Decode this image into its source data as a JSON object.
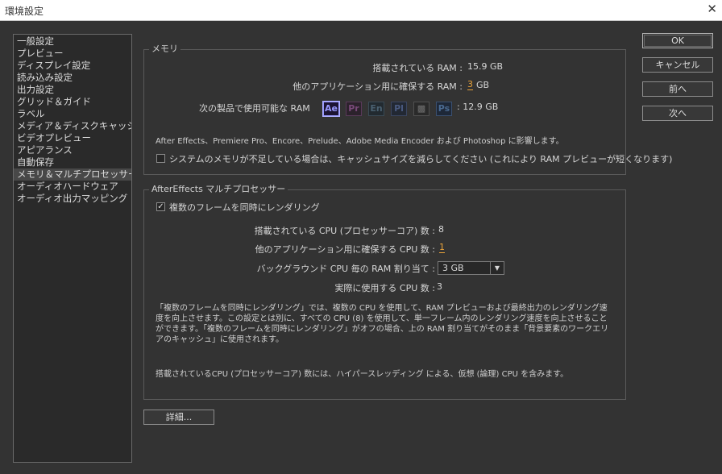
{
  "window": {
    "title": "環境設定",
    "close_glyph": "✕"
  },
  "sidebar": {
    "items": [
      {
        "label": "一般設定"
      },
      {
        "label": "プレビュー"
      },
      {
        "label": "ディスプレイ設定"
      },
      {
        "label": "読み込み設定"
      },
      {
        "label": "出力設定"
      },
      {
        "label": "グリッド＆ガイド"
      },
      {
        "label": "ラベル"
      },
      {
        "label": "メディア＆ディスクキャッシュ"
      },
      {
        "label": "ビデオプレビュー"
      },
      {
        "label": "アピアランス"
      },
      {
        "label": "自動保存"
      },
      {
        "label": "メモリ＆マルチプロセッサー",
        "selected": true
      },
      {
        "label": "オーディオハードウェア"
      },
      {
        "label": "オーディオ出力マッピング"
      }
    ]
  },
  "memory": {
    "legend": "メモリ",
    "installed_label": "搭載されている RAM :",
    "installed_value": "15.9 GB",
    "reserved_label": "他のアプリケーション用に確保する RAM :",
    "reserved_value": "3",
    "reserved_unit": "GB",
    "available_label": "次の製品で使用可能な RAM",
    "available_value": ": 12.9 GB",
    "apps": [
      {
        "abbr": "Ae",
        "icon": "after-effects-icon",
        "fg": "#9999ff",
        "bg": "#1c1433",
        "border": "#9999ff"
      },
      {
        "abbr": "Pr",
        "icon": "premiere-pro-icon",
        "fg": "#7a4a7a",
        "bg": "#2c222c",
        "border": "#5a3a5a"
      },
      {
        "abbr": "En",
        "icon": "encore-icon",
        "fg": "#4a6070",
        "bg": "#222a30",
        "border": "#3a4a55"
      },
      {
        "abbr": "Pl",
        "icon": "prelude-icon",
        "fg": "#4a5a80",
        "bg": "#222833",
        "border": "#3a4560"
      },
      {
        "abbr": "▩",
        "icon": "media-encoder-icon",
        "fg": "#707070",
        "bg": "#2a2a2a",
        "border": "#505050"
      },
      {
        "abbr": "Ps",
        "icon": "photoshop-icon",
        "fg": "#4a6a90",
        "bg": "#1e2838",
        "border": "#3a5070"
      }
    ],
    "note": "After Effects、Premiere Pro、Encore、Prelude、Adobe Media Encoder および Photoshop に影響します。",
    "reduce_cache_label": "システムのメモリが不足している場合は、キャッシュサイズを減らしてください (これにより RAM プレビューが短くなります)",
    "reduce_cache_checked": false
  },
  "mp": {
    "legend": "AfterEffects マルチプロセッサー",
    "render_multi_label": "複数のフレームを同時にレンダリング",
    "render_multi_checked": true,
    "cpu_installed_label": "搭載されている CPU (プロセッサーコア) 数 :",
    "cpu_installed_value": "8",
    "cpu_reserved_label": "他のアプリケーション用に確保する CPU 数 :",
    "cpu_reserved_value": "1",
    "bg_ram_label": "バックグラウンド CPU 毎の RAM 割り当て :",
    "bg_ram_value": "3 GB",
    "actual_cpu_label": "実際に使用する CPU 数 :",
    "actual_cpu_value": "3",
    "description": "「複数のフレームを同時にレンダリング」では、複数の CPU を使用して、RAM プレビューおよび最終出力のレンダリング速度を向上させます。この設定とは別に、すべての CPU (8) を使用して、単一フレーム内のレンダリング速度を向上させることができます。「複数のフレームを同時にレンダリング」がオフの場合、上の RAM 割り当てがそのまま「背景要素のワークエリアのキャッシュ」に使用されます。",
    "footnote": "搭載されているCPU (プロセッサーコア) 数には、ハイパースレッディング による、仮想 (論理) CPU を含みます。"
  },
  "buttons": {
    "ok": "OK",
    "cancel": "キャンセル",
    "prev": "前へ",
    "next": "次へ",
    "details": "詳細..."
  }
}
